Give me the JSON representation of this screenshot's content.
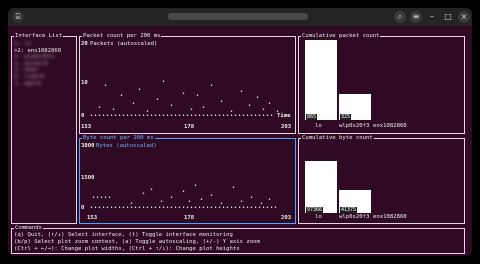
{
  "titlebar": {
    "icon": "terminal-icon",
    "buttons": [
      "search-icon",
      "menu-icon",
      "minimize-icon",
      "maximize-icon",
      "close-icon"
    ]
  },
  "interfaces": {
    "title": "Interface List",
    "items": [
      "1: lo",
      ">2: enx1082860",
      "3: wlp0s20f3",
      "4: docker0",
      "5: demo",
      "6: lxdbr0",
      "7: mpbr0"
    ],
    "selected_index": 1
  },
  "packet_plot": {
    "title": "Packet count per 200 ms",
    "subtitle": "Packets (autoscaled)",
    "y_ticks": [
      "20",
      "10",
      "0"
    ],
    "x_ticks": [
      "153",
      "178",
      "203"
    ],
    "x_axis_label": "Time"
  },
  "byte_plot": {
    "title": "Byte count per 200 ms",
    "subtitle": "Bytes (autoscaled)",
    "y_ticks": [
      "3000",
      "1500",
      "0"
    ],
    "x_ticks": [
      "153",
      "178",
      "203"
    ]
  },
  "cum_packets": {
    "title": "Cumulative packet count",
    "bars": [
      {
        "label": "lo",
        "value": "865",
        "fraction": 1.0
      },
      {
        "label": "wlp0s20f3",
        "value": "325",
        "fraction": 0.33
      },
      {
        "label": "enx1082860",
        "value": "",
        "fraction": 0.0
      }
    ]
  },
  "cum_bytes": {
    "title": "Cumulative byte count",
    "bars": [
      {
        "label": "lo",
        "value": "97366",
        "fraction": 1.0
      },
      {
        "label": "wlp0s20f3",
        "value": "41375",
        "fraction": 0.45
      },
      {
        "label": "enx1082860",
        "value": "",
        "fraction": 0.0
      }
    ]
  },
  "commands": {
    "title": "Commands",
    "lines": [
      "(q) Quit, (↑/↓) Select interface, (t) Toggle interface monitoring",
      "(b/p) Select plot zoom context, (a) Toggle autoscaling, (+/-) Y axis zoom",
      "(Ctrl + ←/→): Change plot widths, (Ctrl + ↑/↓): Change plot heights"
    ]
  },
  "colors": {
    "terminal_bg": "#300a24",
    "border": "#e5d5e0",
    "highlight": "#4aa8ff"
  }
}
